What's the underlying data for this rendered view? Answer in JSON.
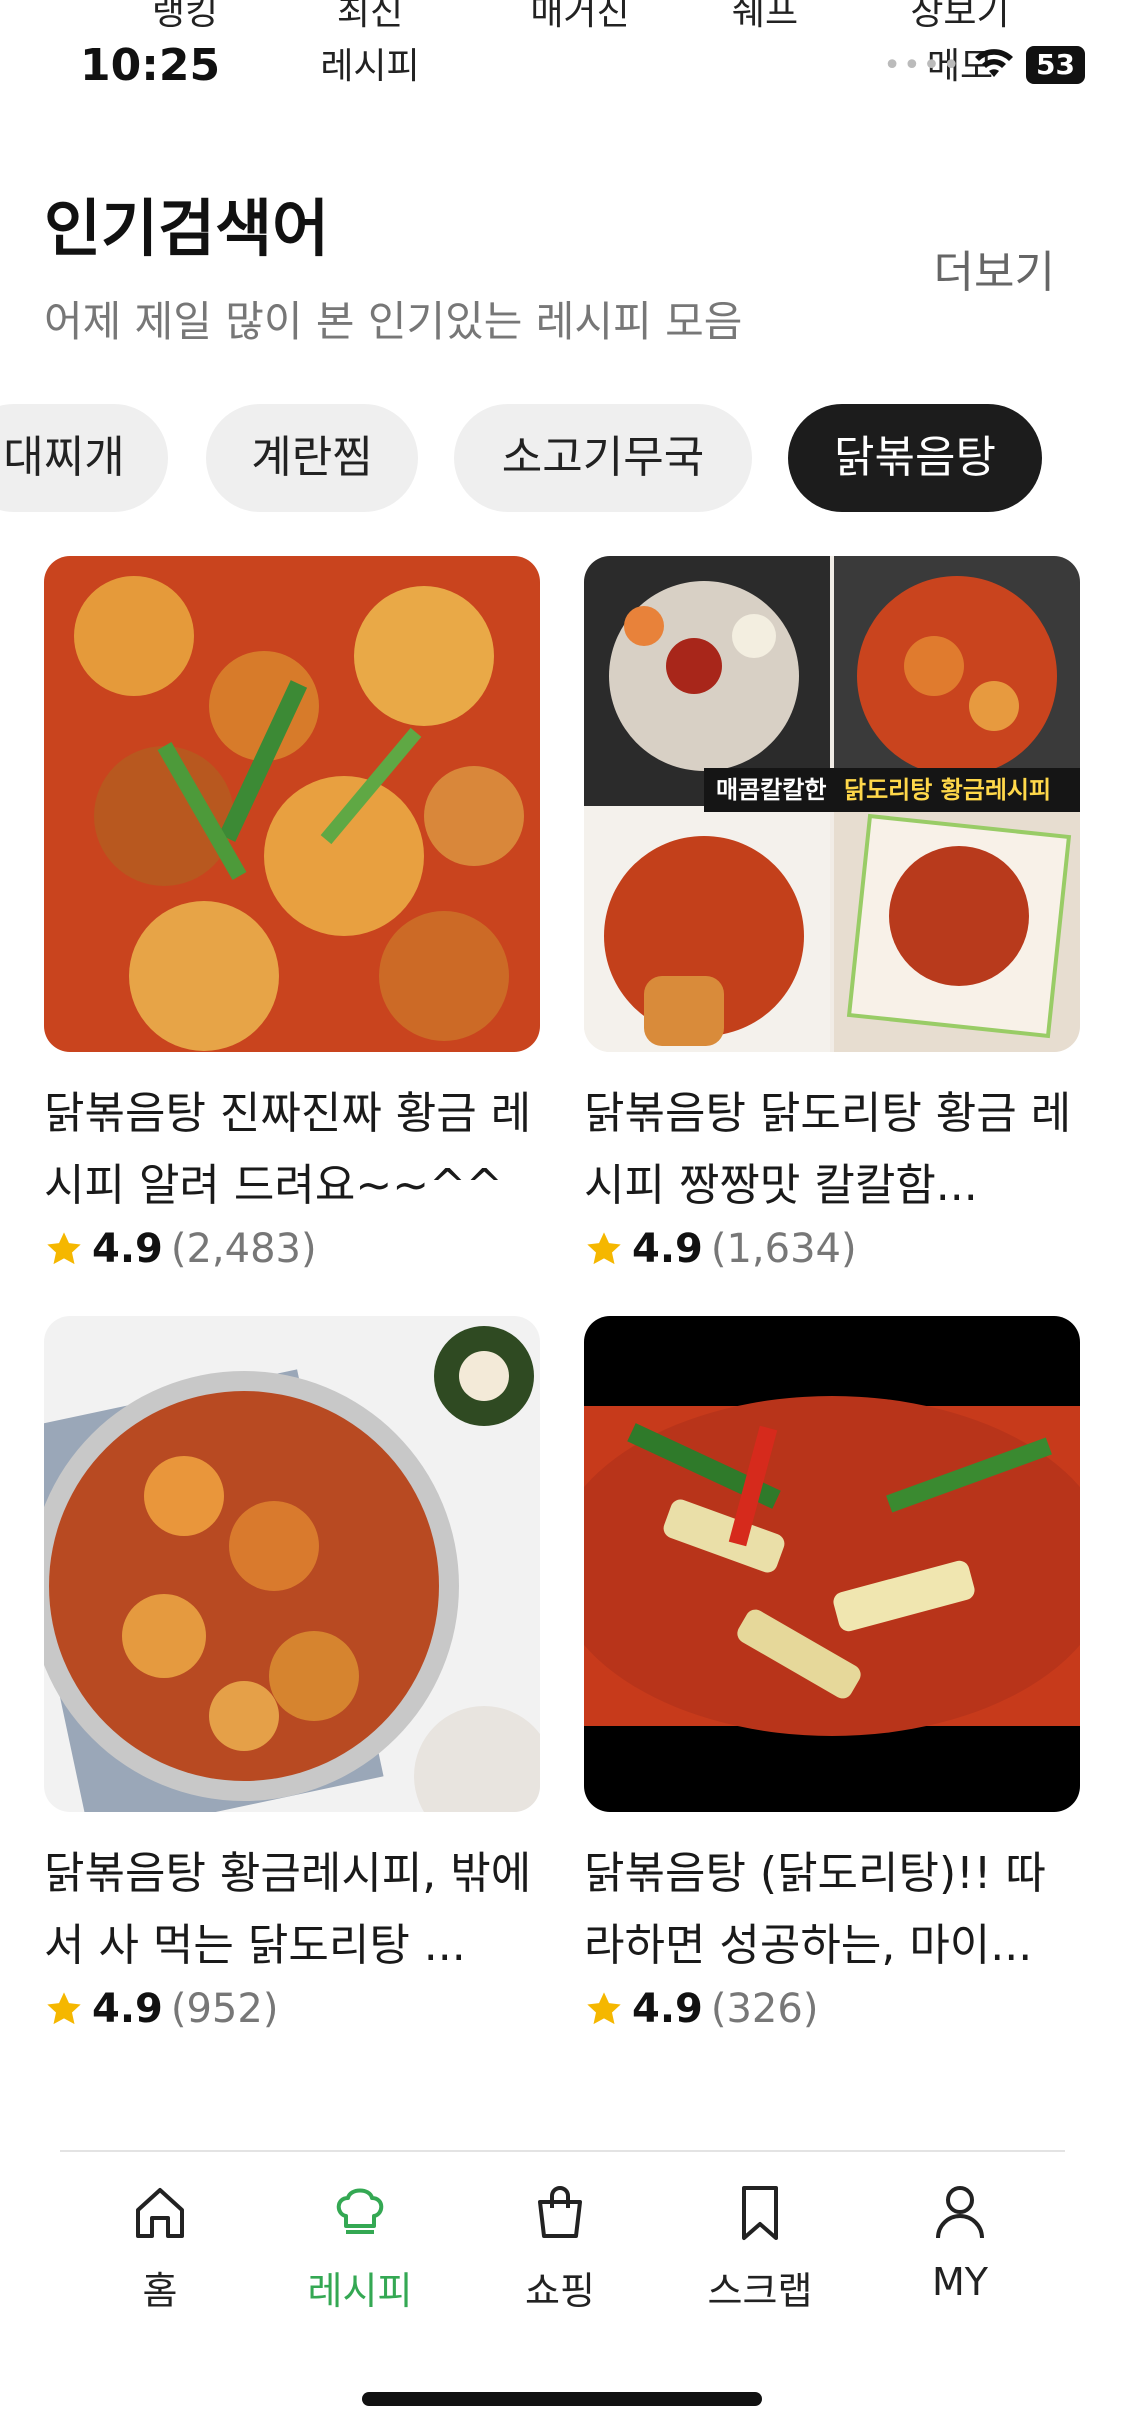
{
  "top_tabs": [
    "랭킹",
    "최신\n레시피",
    "매거진",
    "쉐프",
    "장보기\n메모"
  ],
  "status": {
    "time": "10:25",
    "battery": "53"
  },
  "section": {
    "title": "인기검색어",
    "subtitle": "어제 제일 많이 본 인기있는 레시피 모음",
    "more": "더보기"
  },
  "chips": [
    "대찌개",
    "계란찜",
    "소고기무국",
    "닭볶음탕"
  ],
  "recipes": [
    {
      "title": "닭볶음탕 진짜진짜 황금 레시피 알려 드려요~~^^",
      "rating": "4.9",
      "count": "(2,483)"
    },
    {
      "title": "닭볶음탕 닭도리탕 황금 레시피 짱짱맛 칼칼함...",
      "rating": "4.9",
      "count": "(1,634)",
      "thumb_caption_a": "매콤칼칼한",
      "thumb_caption_b": "닭도리탕 황금레시피"
    },
    {
      "title": "닭볶음탕 황금레시피, 밖에서 사 먹는 닭도리탕 ...",
      "rating": "4.9",
      "count": "(952)"
    },
    {
      "title": "닭볶음탕 (닭도리탕)!! 따라하면 성공하는, 마이...",
      "rating": "4.9",
      "count": "(326)"
    }
  ],
  "nav": [
    {
      "label": "홈",
      "icon": "home-icon"
    },
    {
      "label": "레시피",
      "icon": "chef-hat-icon",
      "active": true
    },
    {
      "label": "쇼핑",
      "icon": "shopping-bag-icon"
    },
    {
      "label": "스크랩",
      "icon": "bookmark-icon"
    },
    {
      "label": "MY",
      "icon": "person-icon"
    }
  ],
  "colors": {
    "accent": "#34a853",
    "star": "#f5b700",
    "chip_active": "#1c1c1c",
    "chip": "#efefef"
  }
}
